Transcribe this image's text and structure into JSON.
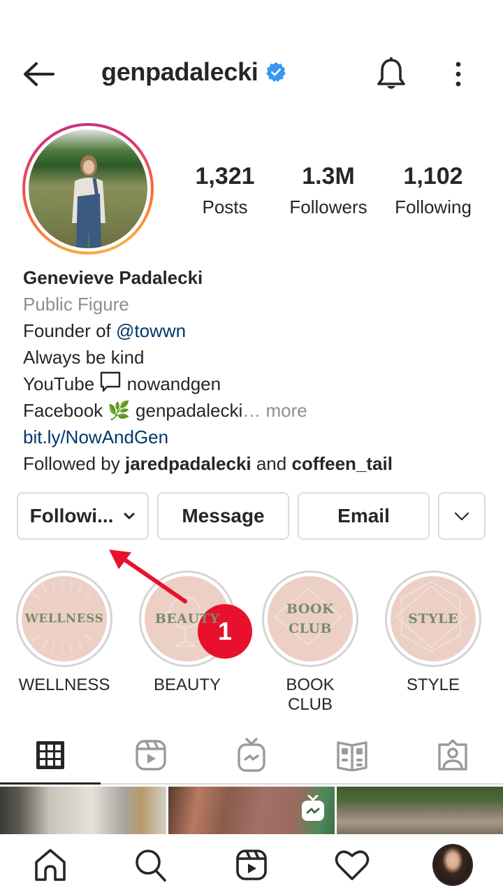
{
  "header": {
    "back_icon": "arrow-left-icon",
    "username": "genpadalecki",
    "verified_icon": "verified-badge-icon",
    "verified_color": "#3897f0",
    "bell_icon": "bell-icon",
    "more_icon": "vertical-dots-icon"
  },
  "profile": {
    "avatar_description": "Woman in denim overalls standing in a meadow",
    "story_ring_colors": [
      "#fcaf45",
      "#f77737",
      "#e1306c",
      "#c13584"
    ],
    "stats": {
      "posts": {
        "value": "1,321",
        "label": "Posts"
      },
      "followers": {
        "value": "1.3M",
        "label": "Followers"
      },
      "following": {
        "value": "1,102",
        "label": "Following"
      }
    }
  },
  "bio": {
    "name": "Genevieve Padalecki",
    "category": "Public Figure",
    "line1_prefix": "Founder of ",
    "line1_mention": "@towwn",
    "line2": "Always be kind",
    "line3_prefix": "YouTube",
    "line3_icon": "speech-bubble-icon",
    "line3_suffix": "nowandgen",
    "line4_prefix": "Facebook",
    "line4_emoji": "🌿",
    "line4_suffix": "genpadalecki",
    "line4_ellipsis": "…",
    "more_label": " more",
    "website": "bit.ly/NowAndGen",
    "followed_by_prefix": "Followed by ",
    "followed_by_user1": "jaredpadalecki",
    "followed_by_and": " and ",
    "followed_by_user2": "coffeen_tail",
    "link_color": "#00376b"
  },
  "actions": {
    "following_label": "Followi...",
    "message_label": "Message",
    "email_label": "Email",
    "more_icon": "chevron-down-icon"
  },
  "highlights": [
    {
      "cover_text": "WELLNESS",
      "label": "WELLNESS"
    },
    {
      "cover_text": "BEAUTY",
      "label": "BEAUTY"
    },
    {
      "cover_text_line1": "BOOK",
      "cover_text_line2": "CLUB",
      "label": "BOOK CLUB"
    },
    {
      "cover_text": "STYLE",
      "label": "STYLE"
    }
  ],
  "annotation": {
    "badge_number": "1",
    "color": "#e8112d"
  },
  "tabs": [
    {
      "name": "posts-grid",
      "icon": "grid-icon",
      "active": true
    },
    {
      "name": "reels",
      "icon": "reels-icon",
      "active": false
    },
    {
      "name": "igtv",
      "icon": "igtv-icon",
      "active": false
    },
    {
      "name": "guides",
      "icon": "guides-icon",
      "active": false
    },
    {
      "name": "tagged",
      "icon": "tagged-user-icon",
      "active": false
    }
  ],
  "grid_posts": [
    {
      "description": "Person with towel on head in a library room"
    },
    {
      "description": "Woman reading a book titled Once",
      "igtv_badge": "igtv-icon"
    },
    {
      "description": "Giant mushroom sculpture among trees"
    }
  ],
  "bottom_nav": [
    {
      "name": "home",
      "icon": "home-icon"
    },
    {
      "name": "search",
      "icon": "search-icon"
    },
    {
      "name": "reels",
      "icon": "reels-icon"
    },
    {
      "name": "activity",
      "icon": "heart-icon"
    },
    {
      "name": "profile",
      "icon": "profile-avatar"
    }
  ]
}
